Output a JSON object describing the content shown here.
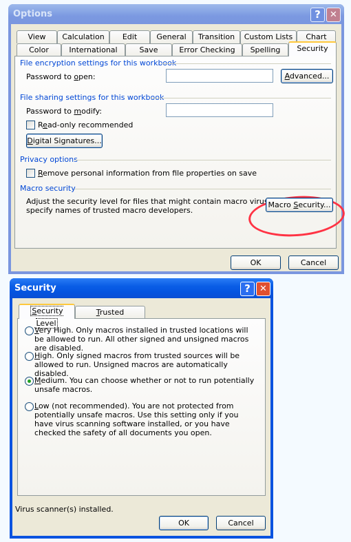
{
  "options_dialog": {
    "title": "Options",
    "help_button": "?",
    "close_button": "✕",
    "tabs_row1": [
      "View",
      "Calculation",
      "Edit",
      "General",
      "Transition",
      "Custom Lists",
      "Chart"
    ],
    "tabs_row2": [
      "Color",
      "International",
      "Save",
      "Error Checking",
      "Spelling",
      "Security"
    ],
    "active_tab": "Security",
    "encryption_group": "File encryption settings for this workbook",
    "password_open_label": "Password to open:",
    "password_open_value": "",
    "advanced_button": "Advanced...",
    "sharing_group": "File sharing settings for this workbook",
    "password_modify_label": "Password to modify:",
    "password_modify_value": "",
    "readonly_label": "Read-only recommended",
    "readonly_checked": false,
    "digital_signatures_button": "Digital Signatures...",
    "privacy_group": "Privacy options",
    "remove_personal_label": "Remove personal information from file properties on save",
    "remove_personal_checked": false,
    "macro_group": "Macro security",
    "macro_description_line1": "Adjust the security level for files that might contain macro viruses and",
    "macro_description_line2": "specify names of trusted macro developers.",
    "macro_security_button": "Macro Security...",
    "ok_button": "OK",
    "cancel_button": "Cancel"
  },
  "security_dialog": {
    "title": "Security",
    "help_button": "?",
    "close_button": "✕",
    "tabs": [
      "Security Level",
      "Trusted Publishers"
    ],
    "active_tab": "Security Level",
    "options": [
      {
        "label": "Very High. Only macros installed in trusted locations will be allowed to run. All other signed and unsigned macros are disabled.",
        "selected": false
      },
      {
        "label": "High. Only signed macros from trusted sources will be allowed to run. Unsigned macros are automatically disabled.",
        "selected": false
      },
      {
        "label": "Medium. You can choose whether or not to run potentially unsafe macros.",
        "selected": true
      },
      {
        "label": "Low (not recommended). You are not protected from potentially unsafe macros. Use this setting only if you have virus scanning software installed, or you have checked the safety of all documents you open.",
        "selected": false
      }
    ],
    "status_text": "Virus scanner(s) installed.",
    "ok_button": "OK",
    "cancel_button": "Cancel"
  },
  "annotation": {
    "color": "#ff3344",
    "target": "Macro Security..."
  }
}
